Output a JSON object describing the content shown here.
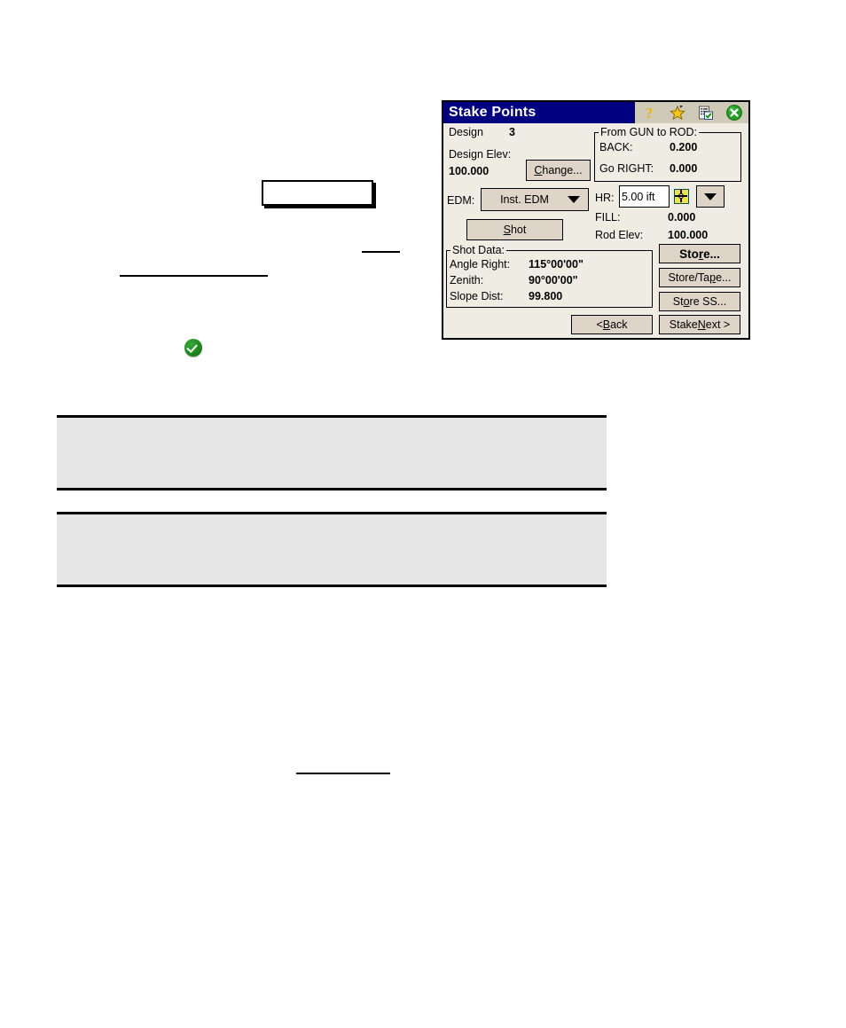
{
  "document": {
    "redacted_text_blocks": [
      {
        "type": "empty-bordered-box"
      },
      {
        "type": "underline-short"
      },
      {
        "type": "underline-long"
      },
      {
        "type": "green-check-bullet"
      },
      {
        "type": "gray-note-box"
      },
      {
        "type": "gray-note-box"
      },
      {
        "type": "underline-short"
      }
    ]
  },
  "dialog": {
    "title": "Stake Points",
    "title_icons": [
      {
        "name": "help-icon",
        "glyph": "?"
      },
      {
        "name": "favorites-star-icon",
        "glyph": "★"
      },
      {
        "name": "task-list-icon",
        "glyph": "☑"
      },
      {
        "name": "close-icon",
        "glyph": "✕"
      }
    ],
    "colors": {
      "titlebar": "#000080",
      "titlebar_text": "#ffffff",
      "window_bg": "#efece4",
      "button_face": "#ded5c8",
      "icon_tray": "#cfc9b8",
      "close_green": "#22a022",
      "star_yellow": "#f5c518"
    },
    "fields": {
      "design_label": "Design",
      "design_value": "3",
      "design_elev_label": "Design Elev:",
      "design_elev_value": "100.000",
      "edm_label": "EDM:",
      "edm_value": "Inst. EDM",
      "hr_label": "HR:",
      "hr_value": "5.00 ift",
      "fill_label": "FILL:",
      "fill_value": "0.000",
      "rod_elev_label": "Rod Elev:",
      "rod_elev_value": "100.000"
    },
    "gun_to_rod": {
      "title": "From GUN to ROD:",
      "rows": [
        {
          "label": "BACK:",
          "value": "0.200"
        },
        {
          "label": "Go RIGHT:",
          "value": "0.000"
        }
      ]
    },
    "shot_data": {
      "title": "Shot Data:",
      "rows": [
        {
          "label": "Angle Right:",
          "value": "115°00'00\""
        },
        {
          "label": "Zenith:",
          "value": "90°00'00\""
        },
        {
          "label": "Slope Dist:",
          "value": "99.800"
        }
      ]
    },
    "buttons": {
      "change": {
        "pre": "",
        "accel": "C",
        "post": "hange..."
      },
      "shot": {
        "pre": "",
        "accel": "S",
        "post": "hot"
      },
      "store": {
        "pre": "Sto",
        "accel": "r",
        "post": "e..."
      },
      "store_tape": {
        "pre": "Store/Ta",
        "accel": "p",
        "post": "e..."
      },
      "store_ss": {
        "pre": "St",
        "accel": "o",
        "post": "re SS..."
      },
      "back": {
        "pre": "< ",
        "accel": "B",
        "post": "ack"
      },
      "stake_next": {
        "pre": "Stake ",
        "accel": "N",
        "post": "ext >"
      }
    }
  }
}
